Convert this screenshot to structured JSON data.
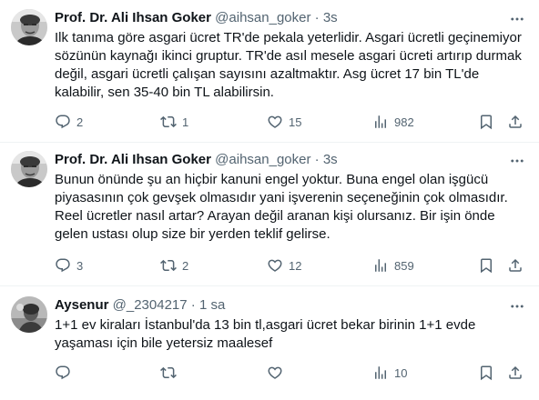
{
  "tweets": [
    {
      "name": "Prof. Dr. Ali Ihsan Goker",
      "handle": "@aihsan_goker",
      "dot": "·",
      "time": "3s",
      "text": "Ilk tanıma göre asgari ücret TR'de pekala yeterlidir. Asgari ücretli geçinemiyor sözünün kaynağı ikinci gruptur. TR'de asıl mesele asgari ücreti artırıp durmak değil, asgari ücretli çalışan sayısını azaltmaktır. Asg ücret 17 bin TL'de kalabilir, sen 35-40 bin TL alabilirsin.",
      "replies": "2",
      "retweets": "1",
      "likes": "15",
      "views": "982"
    },
    {
      "name": "Prof. Dr. Ali Ihsan Goker",
      "handle": "@aihsan_goker",
      "dot": "·",
      "time": "3s",
      "text": "Bunun önünde şu an hiçbir kanuni engel yoktur. Buna engel olan işgücü piyasasının çok gevşek olmasıdır yani işverenin seçeneğinin çok olmasıdır. Reel ücretler nasıl artar? Arayan değil aranan kişi olursanız. Bir işin önde gelen ustası olup size bir yerden teklif gelirse.",
      "replies": "3",
      "retweets": "2",
      "likes": "12",
      "views": "859"
    },
    {
      "name": "Aysenur",
      "handle": "@_2304217",
      "dot": "·",
      "time": "1 sa",
      "text": "1+1 ev kiraları İstanbul'da 13 bin tl,asgari ücret bekar birinin 1+1 evde yaşaması için bile yetersiz maalesef",
      "replies": "",
      "retweets": "",
      "likes": "",
      "views": "10"
    }
  ],
  "icons": {
    "more": "more-dots-icon",
    "reply": "reply-icon",
    "retweet": "retweet-icon",
    "like": "heart-icon",
    "views": "views-icon",
    "bookmark": "bookmark-icon",
    "share": "share-icon"
  },
  "colors": {
    "text": "#0f1419",
    "secondary": "#536471",
    "divider": "#eff3f4"
  }
}
